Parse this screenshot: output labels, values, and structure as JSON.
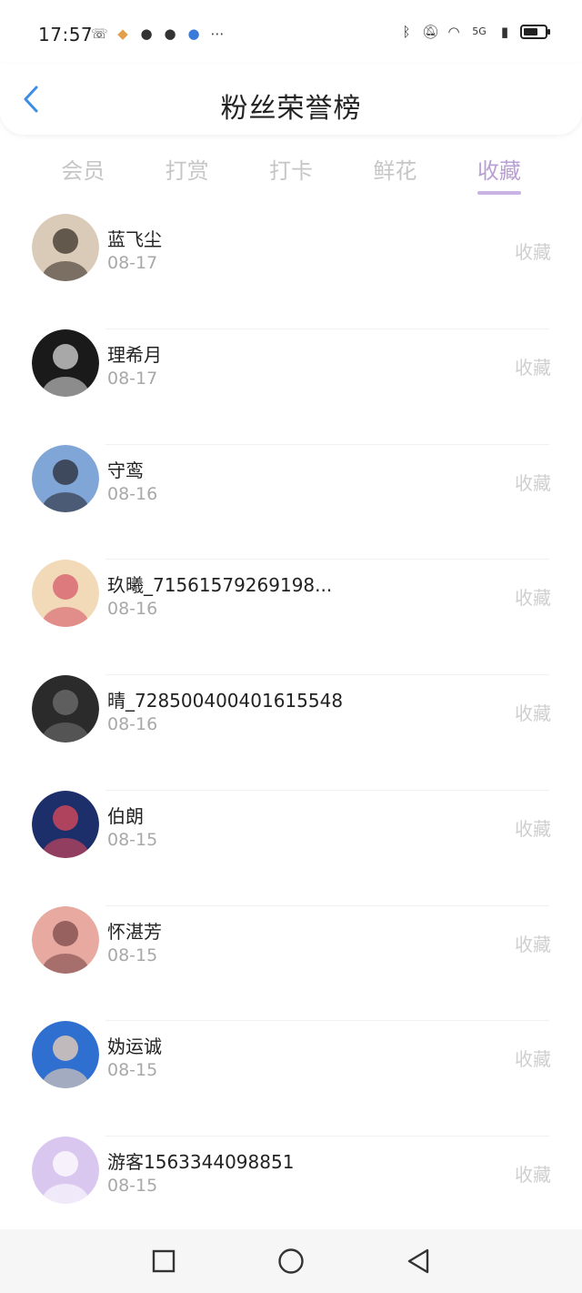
{
  "status": {
    "time": "17:57",
    "network_label": "5G"
  },
  "header": {
    "title": "粉丝荣誉榜"
  },
  "tabs": [
    {
      "label": "会员",
      "active": false
    },
    {
      "label": "打赏",
      "active": false
    },
    {
      "label": "打卡",
      "active": false
    },
    {
      "label": "鲜花",
      "active": false
    },
    {
      "label": "收藏",
      "active": true
    }
  ],
  "list": {
    "items": [
      {
        "name": "蓝飞尘",
        "date": "08-17",
        "action": "收藏",
        "avatar_colors": [
          "#d9cbb8",
          "#3a3228"
        ]
      },
      {
        "name": "理希月",
        "date": "08-17",
        "action": "收藏",
        "avatar_colors": [
          "#1a1a1a",
          "#d8d8d8"
        ]
      },
      {
        "name": "守鸾",
        "date": "08-16",
        "action": "收藏",
        "avatar_colors": [
          "#7fa6d6",
          "#2a2a34"
        ]
      },
      {
        "name": "玖曦_71561579269198...",
        "date": "08-16",
        "action": "收藏",
        "avatar_colors": [
          "#f2d9b8",
          "#d65a6a"
        ]
      },
      {
        "name": "晴_728500400401615548",
        "date": "08-16",
        "action": "收藏",
        "avatar_colors": [
          "#2b2b2b",
          "#707070"
        ]
      },
      {
        "name": "伯朗",
        "date": "08-15",
        "action": "收藏",
        "avatar_colors": [
          "#1d2f6a",
          "#e04a5a"
        ]
      },
      {
        "name": "怀湛芳",
        "date": "08-15",
        "action": "收藏",
        "avatar_colors": [
          "#e8a9a0",
          "#7b4a4a"
        ]
      },
      {
        "name": "妫运诚",
        "date": "08-15",
        "action": "收藏",
        "avatar_colors": [
          "#2f6fd0",
          "#f1d3b5"
        ]
      },
      {
        "name": "游客1563344098851",
        "date": "08-15",
        "action": "收藏",
        "avatar_colors": [
          "#d9c7f0",
          "#ffffff"
        ]
      }
    ]
  },
  "colors": {
    "accent": "#b9a0d4",
    "back_arrow": "#3a8ee6"
  }
}
